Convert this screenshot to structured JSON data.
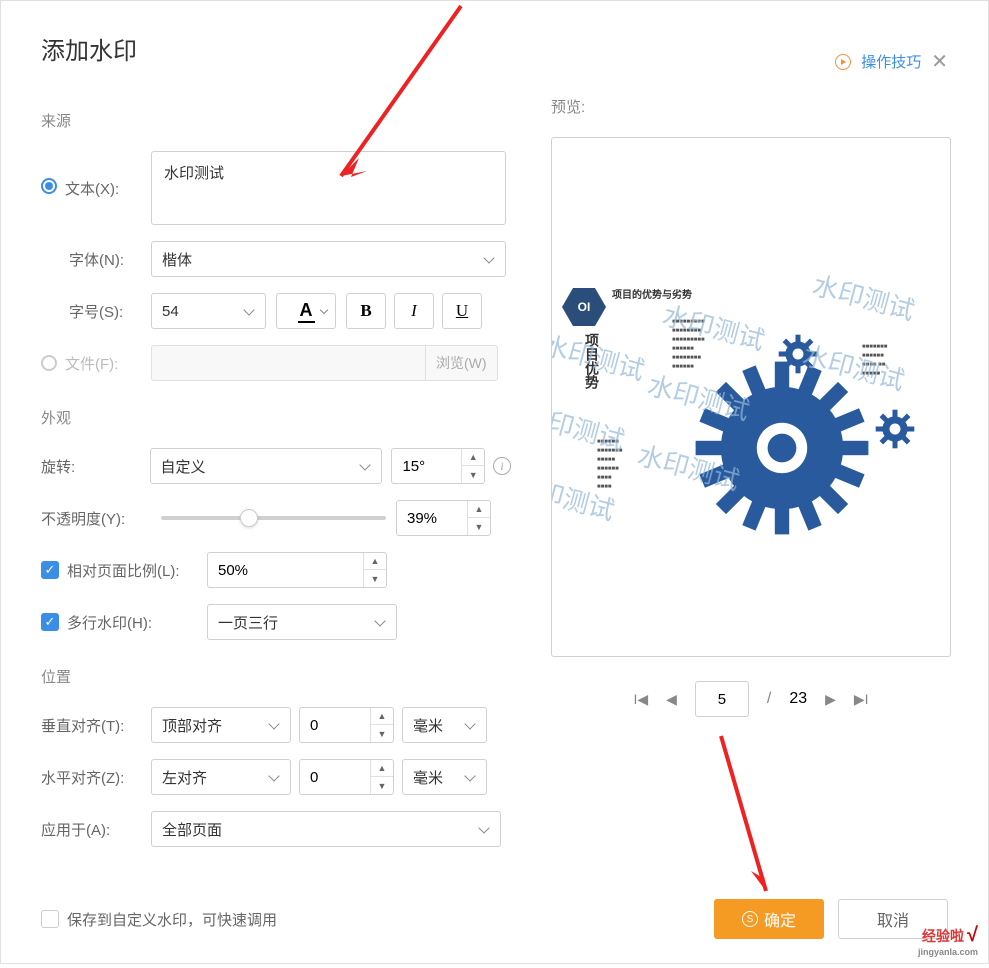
{
  "dialog_title": "添加水印",
  "header": {
    "tips_link": "操作技巧"
  },
  "source": {
    "label": "来源",
    "text_radio_label": "文本(X):",
    "text_value": "水印测试",
    "font_label": "字体(N):",
    "font_value": "楷体",
    "size_label": "字号(S):",
    "size_value": "54",
    "bold": "B",
    "italic": "I",
    "underline": "U",
    "color_a": "A",
    "file_radio_label": "文件(F):",
    "browse_label": "浏览(W)"
  },
  "appearance": {
    "label": "外观",
    "rotate_label": "旋转:",
    "rotate_mode": "自定义",
    "rotate_value": "15°",
    "opacity_label": "不透明度(Y):",
    "opacity_value": "39%",
    "scale_label": "相对页面比例(L):",
    "scale_value": "50%",
    "multiline_label": "多行水印(H):",
    "multiline_value": "一页三行"
  },
  "position": {
    "label": "位置",
    "valign_label": "垂直对齐(T):",
    "valign_value": "顶部对齐",
    "valign_offset": "0",
    "unit1": "毫米",
    "halign_label": "水平对齐(Z):",
    "halign_value": "左对齐",
    "halign_offset": "0",
    "unit2": "毫米",
    "applyto_label": "应用于(A):",
    "applyto_value": "全部页面"
  },
  "preview": {
    "label": "预览:",
    "badge": "OI",
    "slide_title": "项目的优势与劣势",
    "vtext": "项目优势",
    "watermark": "水印测试",
    "current_page": "5",
    "total_pages": "23"
  },
  "footer": {
    "save_custom_label": "保存到自定义水印，可快速调用",
    "ok": "确定",
    "cancel": "取消"
  },
  "logo": {
    "cn": "经验啦",
    "en": "jingyanla.com"
  }
}
